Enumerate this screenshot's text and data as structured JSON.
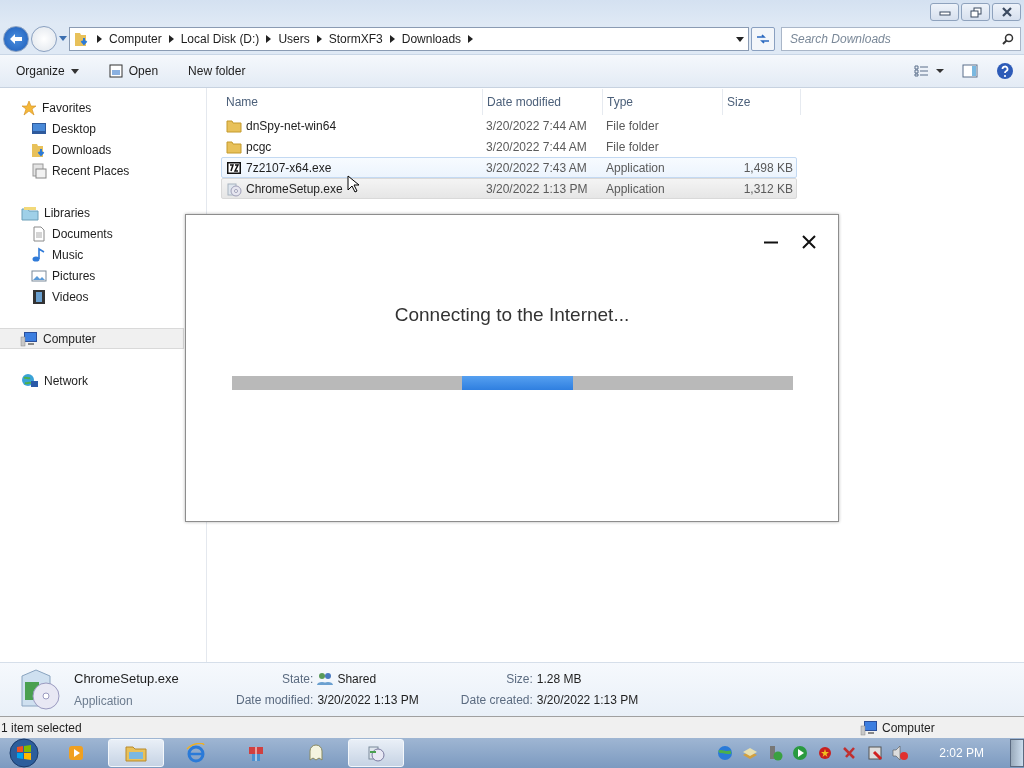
{
  "address_bar": {
    "breadcrumbs": [
      "Computer",
      "Local Disk (D:)",
      "Users",
      "StormXF3",
      "Downloads"
    ]
  },
  "search": {
    "placeholder": "Search Downloads"
  },
  "toolbar": {
    "buttons": [
      {
        "label": "Organize",
        "kind": "menu"
      },
      {
        "label": "Open",
        "kind": "icon"
      },
      {
        "label": "New folder",
        "kind": "plain"
      }
    ]
  },
  "sidebar": {
    "groups": [
      {
        "label": "Favorites",
        "selected": false,
        "children": [
          {
            "label": "Desktop",
            "selected": false
          },
          {
            "label": "Downloads",
            "selected": false
          },
          {
            "label": "Recent Places",
            "selected": false
          }
        ]
      },
      {
        "label": "Libraries",
        "selected": false,
        "children": [
          {
            "label": "Documents",
            "selected": false
          },
          {
            "label": "Music",
            "selected": false
          },
          {
            "label": "Pictures",
            "selected": false
          },
          {
            "label": "Videos",
            "selected": false
          }
        ]
      },
      {
        "label": "Computer",
        "selected": true
      },
      {
        "label": "Network",
        "selected": false
      }
    ]
  },
  "file_list": {
    "columns": [
      "Name",
      "Date modified",
      "Type",
      "Size"
    ],
    "rows": [
      {
        "name": "dnSpy-net-win64",
        "date": "3/20/2022 7:44 AM",
        "type": "File folder",
        "kind": "folder",
        "selected": false,
        "hovered": false
      },
      {
        "name": "pcgc",
        "date": "3/20/2022 7:44 AM",
        "type": "File folder",
        "kind": "folder",
        "selected": false,
        "hovered": false
      },
      {
        "name": "7z2107-x64.exe",
        "date": "3/20/2022 7:43 AM",
        "type": "Application",
        "size": "1,498 KB",
        "kind": "sevenzip",
        "selected": false,
        "hovered": true
      },
      {
        "name": "ChromeSetup.exe",
        "date": "3/20/2022 1:13 PM",
        "type": "Application",
        "size": "1,312 KB",
        "kind": "setup",
        "selected": true,
        "hovered": false
      }
    ]
  },
  "details_pane": {
    "name": "ChromeSetup.exe",
    "type": "Application",
    "fields": [
      {
        "label": "State:",
        "value": "Shared"
      },
      {
        "label": "Size:",
        "value": "1.28 MB"
      },
      {
        "label": "Date modified:",
        "value": "3/20/2022 1:13 PM"
      },
      {
        "label": "Date created:",
        "value": "3/20/2022 1:13 PM"
      }
    ]
  },
  "status_bar": {
    "text": "1 item selected",
    "location": "Computer"
  },
  "dialog": {
    "message": "Connecting to the Internet..."
  },
  "taskbar": {
    "items": [
      {
        "active": false
      },
      {
        "active": true
      },
      {
        "active": false
      },
      {
        "active": false
      },
      {
        "active": false
      },
      {
        "active": true
      }
    ],
    "clock": "2:02 PM"
  }
}
